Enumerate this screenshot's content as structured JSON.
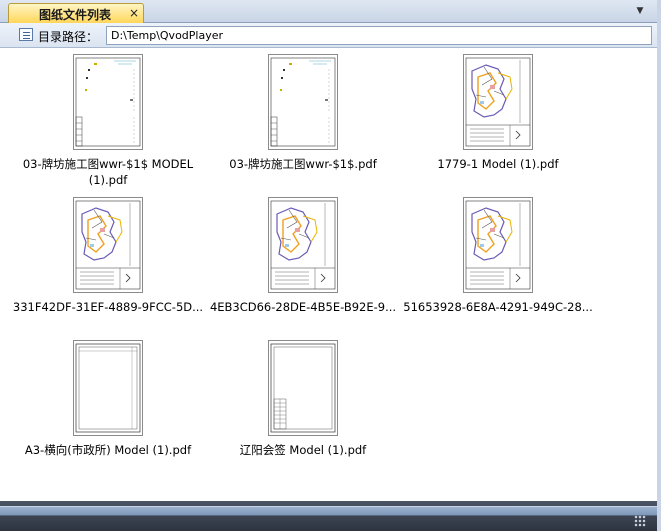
{
  "panel": {
    "tab_label": "图纸文件列表",
    "close_glyph": "×",
    "menu_glyph": "▼"
  },
  "pathbar": {
    "label": "目录路径：",
    "value": "D:\\Temp\\QvodPlayer"
  },
  "files": [
    {
      "line1": "03-牌坊施工图wwr-$1$ MODEL",
      "line2": "(1).pdf",
      "thumbnail": "portrait-title-block"
    },
    {
      "line1": "03-牌坊施工图wwr-$1$.pdf",
      "line2": "",
      "thumbnail": "portrait-title-block"
    },
    {
      "line1": "1779-1 Model (1).pdf",
      "line2": "",
      "thumbnail": "site-map"
    },
    {
      "line1": "331F42DF-31EF-4889-9FCC-5D...",
      "line2": "",
      "thumbnail": "site-map"
    },
    {
      "line1": "4EB3CD66-28DE-4B5E-B92E-9...",
      "line2": "",
      "thumbnail": "site-map"
    },
    {
      "line1": "51653928-6E8A-4291-949C-28...",
      "line2": "",
      "thumbnail": "site-map"
    },
    {
      "line1": "A3-横向(市政所) Model (1).pdf",
      "line2": "",
      "thumbnail": "blank-frame"
    },
    {
      "line1": "辽阳会签 Model (1).pdf",
      "line2": "",
      "thumbnail": "signoff-frame"
    }
  ],
  "colors": {
    "tab_active": "#ffd65a",
    "chrome": "#c9d5e6",
    "bottom_bar": "#2e3440"
  }
}
